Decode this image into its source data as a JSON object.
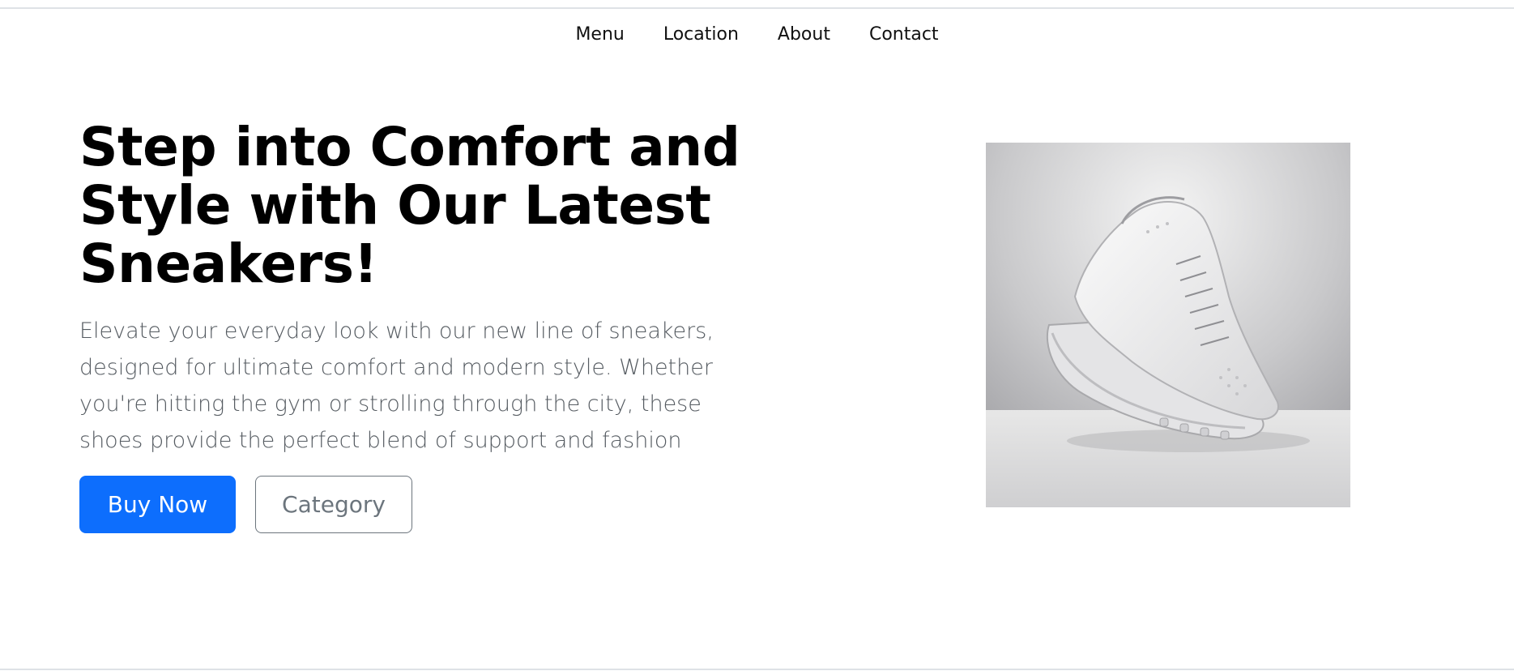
{
  "nav": {
    "items": [
      {
        "label": "Menu"
      },
      {
        "label": "Location"
      },
      {
        "label": "About"
      },
      {
        "label": "Contact"
      }
    ]
  },
  "hero": {
    "title": "Step into Comfort and Style with Our Latest Sneakers!",
    "description": "Elevate your everyday look with our new line of sneakers, designed for ultimate comfort and modern style. Whether you're hitting the gym or strolling through the city, these shoes provide the perfect blend of support and fashion",
    "primary_button": "Buy Now",
    "secondary_button": "Category",
    "image": "white-sneaker-product-photo"
  },
  "colors": {
    "primary": "#0d6efd",
    "secondary": "#6c757d",
    "text_muted": "#555b61"
  }
}
